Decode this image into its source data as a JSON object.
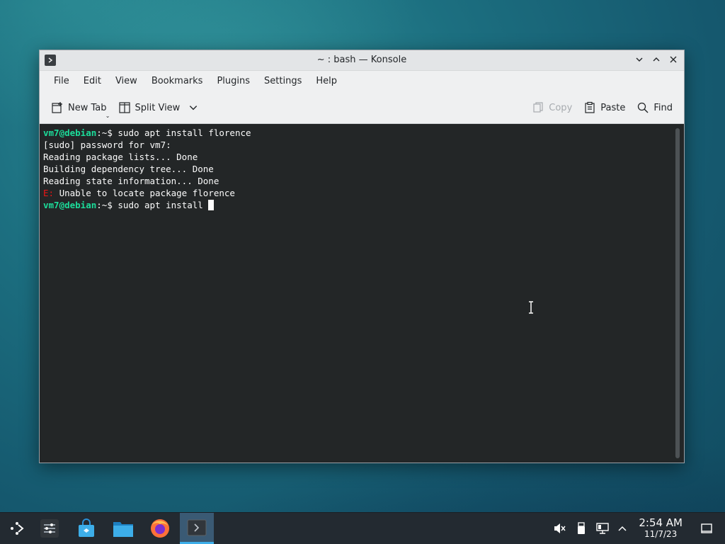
{
  "window": {
    "title": "~ : bash — Konsole"
  },
  "menu": [
    "File",
    "Edit",
    "View",
    "Bookmarks",
    "Plugins",
    "Settings",
    "Help"
  ],
  "toolbar": {
    "new_tab": "New Tab",
    "split_view": "Split View",
    "copy": "Copy",
    "paste": "Paste",
    "find": "Find"
  },
  "terminal": {
    "prompt": "vm7@debian",
    "prompt_suffix": ":~",
    "dollar": "$ ",
    "cmd1": "sudo apt install florence",
    "line2": "[sudo] password for vm7:",
    "line3": "Reading package lists... Done",
    "line4": "Building dependency tree... Done",
    "line5": "Reading state information... Done",
    "err_prefix": "E:",
    "err_msg": " Unable to locate package florence",
    "cmd2": "sudo apt install "
  },
  "taskbar": {
    "clock_time": "2:54 AM",
    "clock_date": "11/7/23"
  },
  "colors": {
    "prompt": "#1cdc9a",
    "error": "#ed1515",
    "terminal_bg": "#232627",
    "taskbar_bg": "#232a31",
    "accent": "#3daee9"
  }
}
